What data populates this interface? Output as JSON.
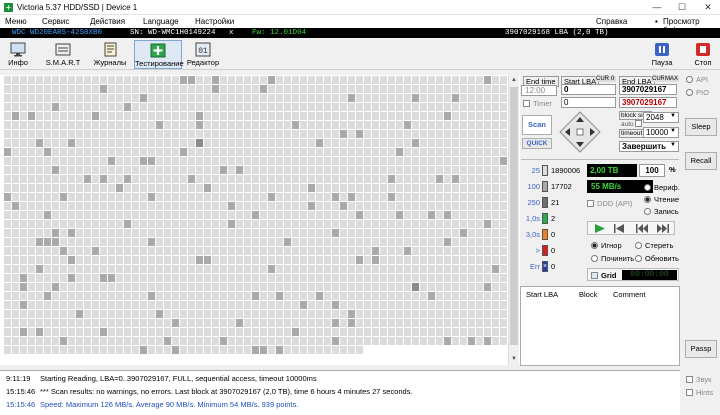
{
  "window": {
    "title": "Victoria 5.37 HDD/SSD | Device 1",
    "minimize": "—",
    "maximize": "☐",
    "close": "✕"
  },
  "menu": {
    "items": [
      "Меню",
      "Сервис",
      "Действия",
      "Language",
      "Настройки"
    ],
    "help": "Справка",
    "clipboard": "Просмотр буфера"
  },
  "info": {
    "model": "WDC WD20EARS-42S0XB0",
    "serial": "SN: WD-WMC1H0149224",
    "close_x": "x",
    "firmware": "Fw: 12.01D04",
    "lba": "3907029168 LBA (2,0 TB)"
  },
  "toolbar": {
    "buttons": [
      "Инфо",
      "S.M.A.R.T",
      "Журналы",
      "Тестирование",
      "Редактор"
    ],
    "pause": "Пауза",
    "stop": "Стоп"
  },
  "scan": {
    "end_time_label": "End time",
    "end_time_value": "12:00",
    "timer_label": "Timer",
    "start_lba_label": "Start LBA",
    "cur_label": "CUR",
    "zero_label": "0",
    "start_lba_value": "0",
    "start_lba_cur": "0",
    "end_lba_label": "End LBA",
    "max_label": "MAX",
    "end_lba_value": "3907029167",
    "end_lba_cur": "3907029167",
    "scan_btn": "Scan",
    "quick_btn": "QUICK",
    "block_size_label": "block size",
    "auto_label": "auto",
    "block_size_value": "2048",
    "timeout_label": "timeout,ms",
    "timeout_value": "10000",
    "finish_select": "Завершить"
  },
  "stats": {
    "rows": [
      {
        "label": "25",
        "value": "1890006",
        "color": "#dcdcdc"
      },
      {
        "label": "100",
        "value": "17702",
        "color": "#a9a9a9"
      },
      {
        "label": "250",
        "value": "21",
        "color": "#6e6e6e"
      },
      {
        "label": "1,0s",
        "value": "2",
        "color": "#22b04a"
      },
      {
        "label": "3,0s",
        "value": "0",
        "color": "#f07f1c"
      },
      {
        "label": ">",
        "value": "0",
        "color": "#e0191a"
      },
      {
        "label": "Err",
        "value": "0",
        "color": "#1e3fb0"
      }
    ],
    "capacity": "2,00 TB",
    "percent": "100",
    "percent_sign": "%",
    "speed": "55 MB/s",
    "ddd": "DDD (API)",
    "verify": "Вериф.",
    "read": "Чтение",
    "write": "Запись",
    "ignore": "Игнор",
    "erase": "Стереть",
    "repair": "Починить",
    "refresh": "Обновить",
    "grid": "Grid",
    "timer_display": "00:00:00"
  },
  "table": {
    "headers": [
      "Start LBA",
      "Block",
      "Comment"
    ]
  },
  "side": {
    "api": "API",
    "pio": "PIO",
    "sleep": "Sleep",
    "recall": "Recall",
    "passp": "Passp",
    "sound": "Звук",
    "hints": "Hints"
  },
  "log": [
    {
      "time": "9:11:19",
      "text": "Starting Reading, LBA=0..3907029167, FULL, sequential access, timeout 10000ms",
      "color": "#000000"
    },
    {
      "time": "15:15:46",
      "text": "*** Scan results: no warnings, no errors. Last block at 3907029167 (2,0 TB), time 6 hours 4 minutes 27 seconds.",
      "color": "#000000"
    },
    {
      "time": "15:15:46",
      "text": "Speed: Maximum 126 MB/s. Average 90 MB/s. Minimum 54 MB/s. 939 points.",
      "color": "#1f4fb8"
    }
  ],
  "colors": {
    "accent": "#3b63c4",
    "lcd_bg": "#000000",
    "lcd_green": "#39d539",
    "lba_red": "#b00000"
  }
}
